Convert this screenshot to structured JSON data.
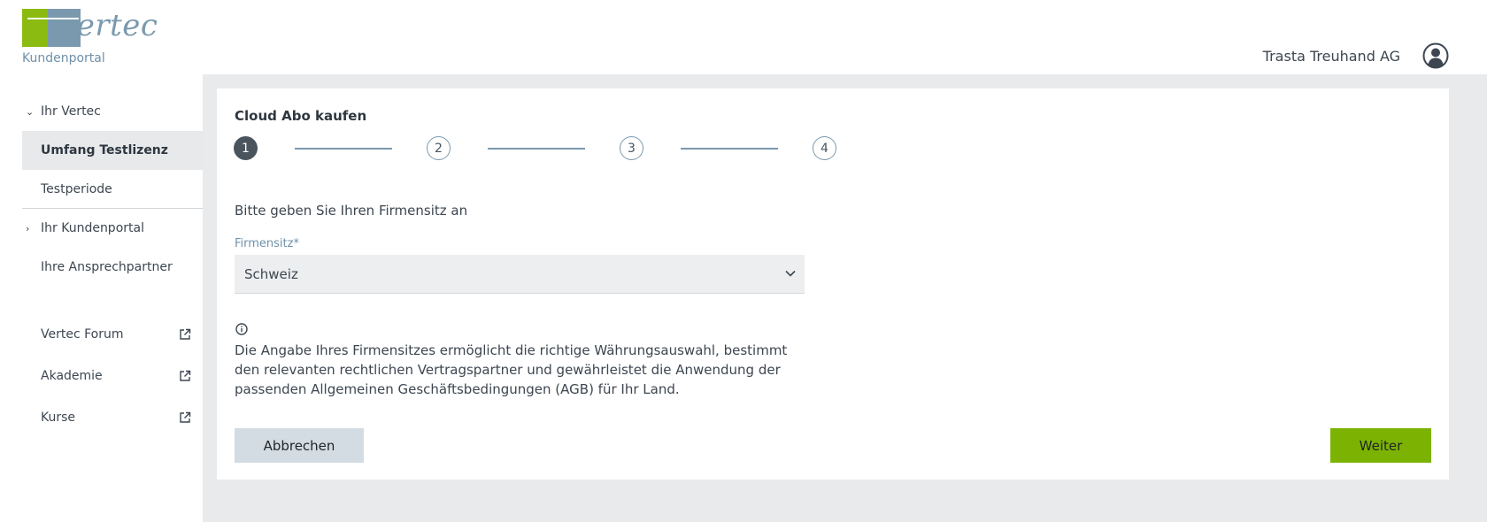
{
  "header": {
    "logo_word": "vertec",
    "logo_subtitle": "Kundenportal",
    "company_name": "Trasta Treuhand AG",
    "user_icon": "user-avatar-icon"
  },
  "sidebar": {
    "items": [
      {
        "label": "Ihr Vertec",
        "chevron": "⌄",
        "expanded": true
      },
      {
        "label": "Umfang Testlizenz",
        "active": true
      },
      {
        "label": "Testperiode"
      },
      {
        "label": "Ihr Kundenportal",
        "chevron": "›",
        "expanded": false
      },
      {
        "label": "Ihre Ansprechpartner"
      }
    ],
    "links": [
      {
        "label": "Vertec Forum",
        "icon": "external-link-icon"
      },
      {
        "label": "Akademie",
        "icon": "external-link-icon"
      },
      {
        "label": "Kurse",
        "icon": "external-link-icon"
      }
    ]
  },
  "main": {
    "title": "Cloud Abo kaufen",
    "steps": [
      "1",
      "2",
      "3",
      "4"
    ],
    "current_step": 1,
    "prompt": "Bitte geben Sie Ihren Firmensitz an",
    "field": {
      "label": "Firmensitz*",
      "value": "Schweiz"
    },
    "info_text": "Die Angabe Ihres Firmensitzes ermöglicht die richtige Währungsauswahl, bestimmt den relevanten rechtlichen Vertragspartner und gewährleistet die Anwendung der passenden Allgemeinen Geschäftsbedingungen (AGB) für Ihr Land.",
    "cancel_label": "Abbrechen",
    "next_label": "Weiter"
  },
  "colors": {
    "brand_green": "#8bbb10",
    "brand_blue": "#7a99ae",
    "button_green": "#7cb302",
    "step_active": "#4a545d"
  }
}
